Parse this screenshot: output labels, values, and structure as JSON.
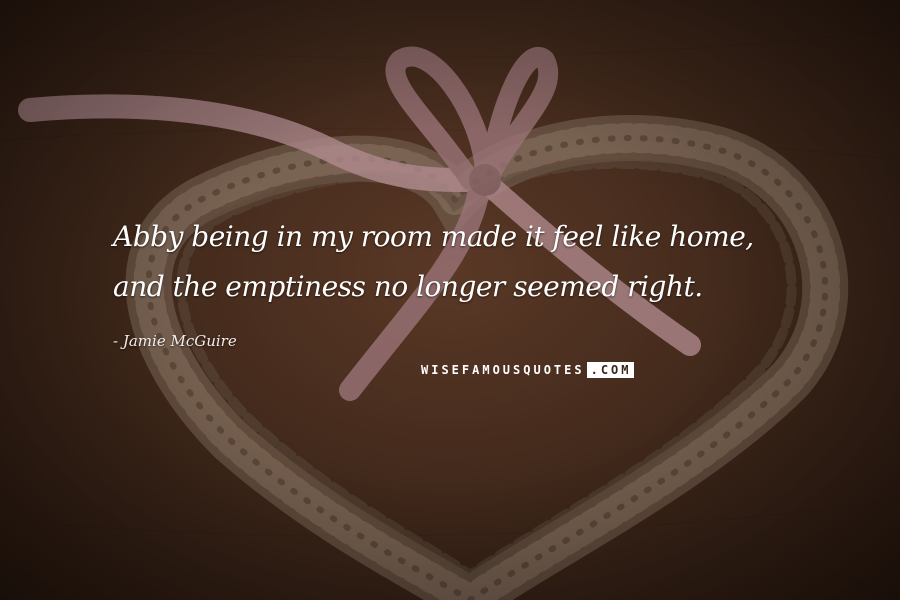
{
  "quote": {
    "text": "Abby being in my room made it feel like home, and the emptiness no longer seemed right.",
    "author": "Jamie McGuire"
  },
  "watermark": {
    "site_name": "WISEFAMOUSQUOTES",
    "domain_suffix": ".COM"
  },
  "background": {
    "subject": "woven wicker heart with gingham ribbon bow on brown fabric",
    "tone_color": "#4a2e1f"
  }
}
